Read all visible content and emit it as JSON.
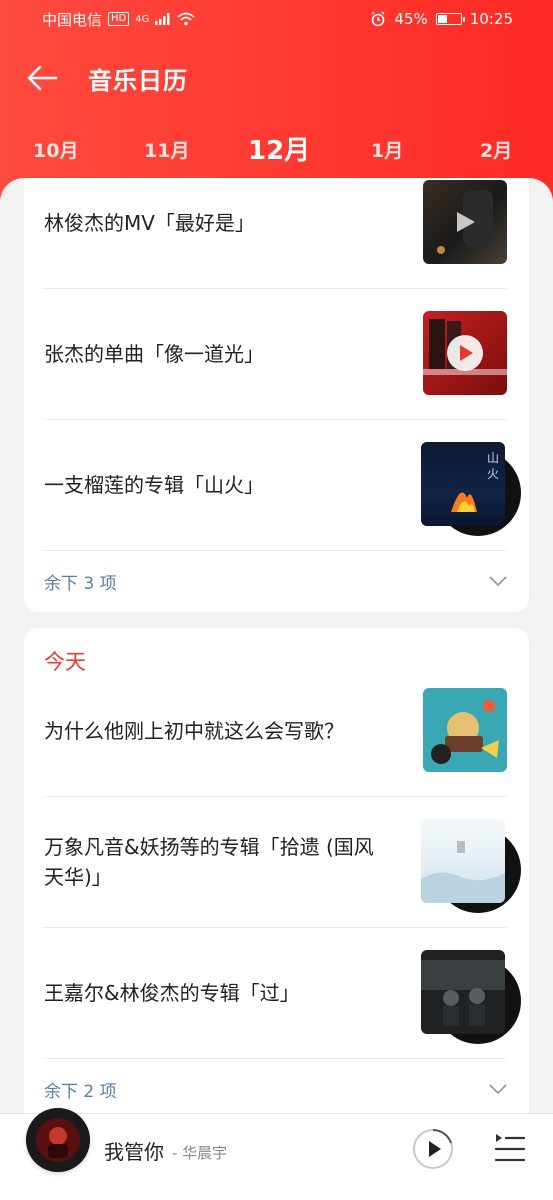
{
  "status_bar": {
    "carrier": "中国电信",
    "hd": "HD",
    "network": "4G",
    "battery": "45%",
    "battery_level": 0.45,
    "time": "10:25"
  },
  "header": {
    "title": "音乐日历",
    "months": [
      "10月",
      "11月",
      "12月",
      "1月",
      "2月"
    ],
    "active_month": "12月"
  },
  "card1": {
    "items": [
      {
        "text": "林俊杰的MV「最好是」",
        "thumb_icon": "video-play-icon"
      },
      {
        "text": "张杰的单曲「像一道光」",
        "thumb_icon": "play-icon"
      },
      {
        "text": "一支榴莲的专辑「山火」",
        "thumb_icon": "album-disc-icon"
      }
    ],
    "more": "余下 3 项"
  },
  "card2": {
    "heading": "今天",
    "items": [
      {
        "text": "为什么他刚上初中就这么会写歌？",
        "thumb_icon": "article-cover"
      },
      {
        "text": "万象凡音&妖扬等的专辑「拾遗 (国风天华)」",
        "thumb_icon": "album-disc-icon"
      },
      {
        "text": "王嘉尔&林俊杰的专辑「过」",
        "thumb_icon": "album-disc-icon"
      }
    ],
    "more": "余下 2 项"
  },
  "player": {
    "song": "我管你",
    "artist": "- 华晨宇"
  },
  "colors": {
    "header_red": "#ff3a30",
    "accent_red": "#e93a2f",
    "link_blue": "#5a7fa8"
  }
}
